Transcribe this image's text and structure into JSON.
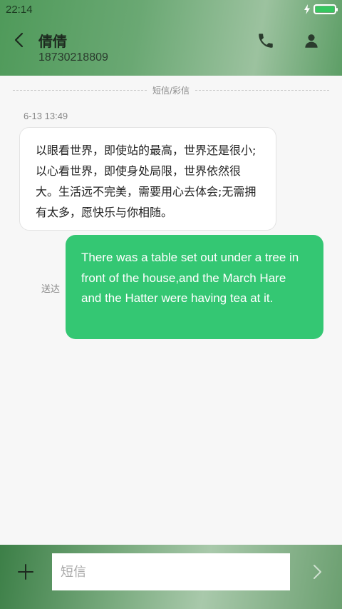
{
  "status_bar": {
    "time": "22:14"
  },
  "header": {
    "contact_name": "倩倩",
    "contact_number": "18730218809"
  },
  "conversation": {
    "divider_label": "短信/彩信",
    "messages": [
      {
        "direction": "incoming",
        "timestamp": "6-13 13:49",
        "text": "以眼看世界，即使站的最高，世界还是很小;以心看世界，即使身处局限，世界依然很大。生活远不完美，需要用心去体会;无需拥有太多，愿快乐与你相随。"
      },
      {
        "direction": "outgoing",
        "status": "送达",
        "text": "There was a table set out under a tree in front of the house,and the March Hare and the Hatter were having tea at it."
      }
    ]
  },
  "composer": {
    "placeholder": "短信",
    "value": ""
  },
  "icons": {
    "back": "chevron-left-icon",
    "call": "phone-icon",
    "profile": "person-icon",
    "add": "plus-icon",
    "send": "chevron-right-icon",
    "charging": "bolt-icon",
    "battery": "battery-icon"
  },
  "colors": {
    "outgoing_bubble": "#34c773",
    "incoming_bubble": "#ffffff",
    "battery_fill": "#36c760"
  }
}
